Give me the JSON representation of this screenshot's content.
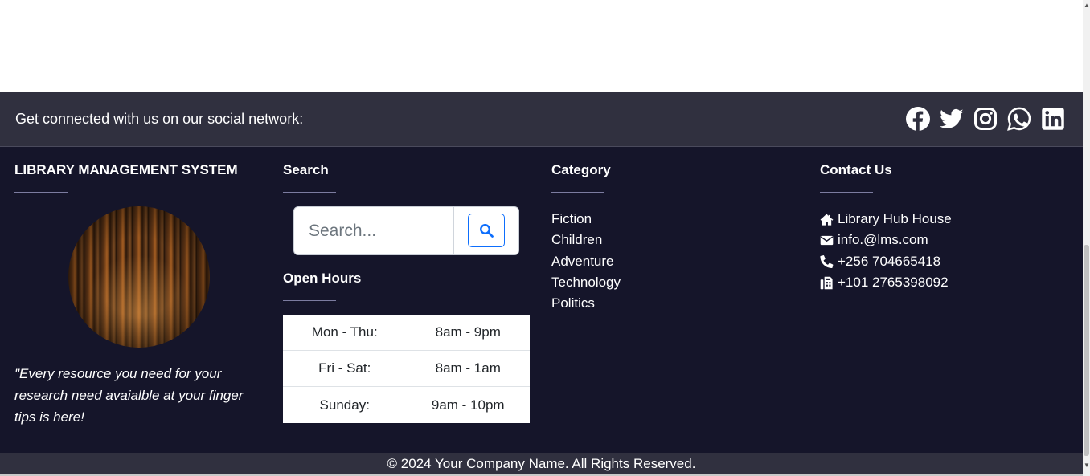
{
  "social": {
    "text": "Get connected with us on our social network:",
    "icons": [
      "facebook-icon",
      "twitter-icon",
      "instagram-icon",
      "whatsapp-icon",
      "linkedin-icon"
    ]
  },
  "about": {
    "title": "LIBRARY MANAGEMENT SYSTEM",
    "quote": "\"Every resource you need for your research need avaialble at your finger tips is here!"
  },
  "search": {
    "title": "Search",
    "placeholder": "Search...",
    "button_icon": "search-icon",
    "accent_color": "#0d6efd"
  },
  "hours": {
    "title": "Open Hours",
    "rows": [
      {
        "day": "Mon - Thu:",
        "time": "8am - 9pm"
      },
      {
        "day": "Fri - Sat:",
        "time": "8am - 1am"
      },
      {
        "day": "Sunday:",
        "time": "9am - 10pm"
      }
    ]
  },
  "category": {
    "title": "Category",
    "items": [
      "Fiction",
      "Children",
      "Adventure",
      "Technology",
      "Politics"
    ]
  },
  "contact": {
    "title": "Contact Us",
    "items": [
      {
        "icon": "home-icon",
        "text": "Library Hub House"
      },
      {
        "icon": "envelope-icon",
        "text": "info.@lms.com"
      },
      {
        "icon": "phone-icon",
        "text": "+256 704665418"
      },
      {
        "icon": "fax-icon",
        "text": "+101 2765398092"
      }
    ]
  },
  "copyright": "© 2024 Your Company Name. All Rights Reserved.",
  "colors": {
    "footer_bg": "#15152a",
    "bar_bg": "#30303f"
  }
}
